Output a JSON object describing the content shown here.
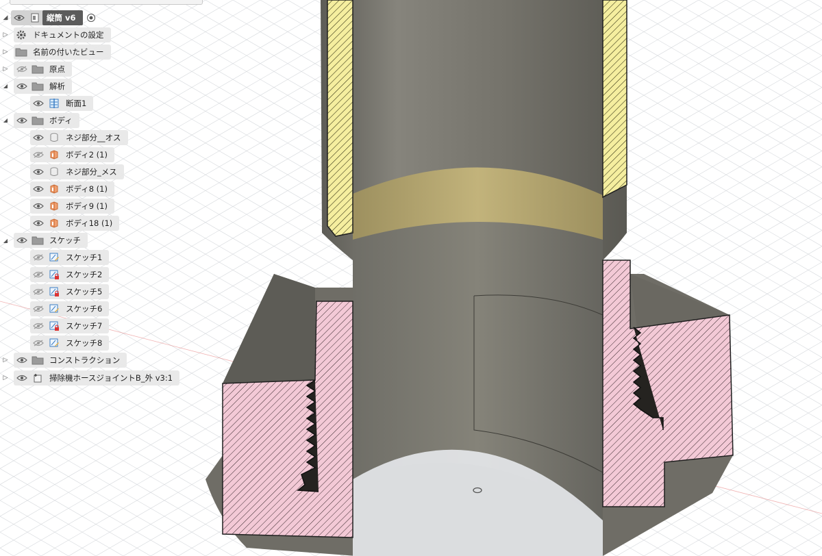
{
  "app": {
    "active_document": "縦筒 v6"
  },
  "browser_tree": {
    "root": {
      "label": "縦筒 v6"
    },
    "nodes": [
      {
        "label": "ドキュメントの設定",
        "icon": "gear-icon",
        "depth": 0,
        "expand": "collapsed",
        "visible": null
      },
      {
        "label": "名前の付いたビュー",
        "icon": "folder-icon",
        "depth": 0,
        "expand": "collapsed",
        "visible": null
      },
      {
        "label": "原点",
        "icon": "folder-icon",
        "depth": 0,
        "expand": "collapsed",
        "visible": false
      },
      {
        "label": "解析",
        "icon": "folder-icon",
        "depth": 0,
        "expand": "expanded",
        "visible": true
      },
      {
        "label": "断面1",
        "icon": "section-analysis-icon",
        "depth": 1,
        "expand": "none",
        "visible": true
      },
      {
        "label": "ボディ",
        "icon": "folder-icon",
        "depth": 0,
        "expand": "expanded",
        "visible": true
      },
      {
        "label": "ネジ部分__オス",
        "icon": "body-white-icon",
        "depth": 1,
        "expand": "none",
        "visible": true
      },
      {
        "label": "ボディ2 (1)",
        "icon": "body-orange-icon",
        "depth": 1,
        "expand": "none",
        "visible": false
      },
      {
        "label": "ネジ部分_メス",
        "icon": "body-white-icon",
        "depth": 1,
        "expand": "none",
        "visible": true
      },
      {
        "label": "ボディ8 (1)",
        "icon": "body-orange-icon",
        "depth": 1,
        "expand": "none",
        "visible": true
      },
      {
        "label": "ボディ9 (1)",
        "icon": "body-orange-icon",
        "depth": 1,
        "expand": "none",
        "visible": true
      },
      {
        "label": "ボディ18 (1)",
        "icon": "body-orange-icon",
        "depth": 1,
        "expand": "none",
        "visible": true
      },
      {
        "label": "スケッチ",
        "icon": "folder-icon",
        "depth": 0,
        "expand": "expanded",
        "visible": true
      },
      {
        "label": "スケッチ1",
        "icon": "sketch-icon",
        "depth": 1,
        "expand": "none",
        "visible": false
      },
      {
        "label": "スケッチ2",
        "icon": "sketch-locked-icon",
        "depth": 1,
        "expand": "none",
        "visible": false
      },
      {
        "label": "スケッチ5",
        "icon": "sketch-locked-icon",
        "depth": 1,
        "expand": "none",
        "visible": false
      },
      {
        "label": "スケッチ6",
        "icon": "sketch-icon",
        "depth": 1,
        "expand": "none",
        "visible": false
      },
      {
        "label": "スケッチ7",
        "icon": "sketch-locked-icon",
        "depth": 1,
        "expand": "none",
        "visible": false
      },
      {
        "label": "スケッチ8",
        "icon": "sketch-icon",
        "depth": 1,
        "expand": "none",
        "visible": false
      },
      {
        "label": "コンストラクション",
        "icon": "folder-icon",
        "depth": 0,
        "expand": "collapsed",
        "visible": true
      },
      {
        "label": "掃除機ホースジョイントB_外 v3:1",
        "icon": "component-link-icon",
        "depth": 0,
        "expand": "collapsed",
        "visible": true
      }
    ]
  },
  "viewport": {
    "colors": {
      "body_gray": "#7c7a72",
      "section_pink": "#f2c6d3",
      "section_yellow": "#f4ec9c",
      "band_tan": "#b8a873",
      "grid_line": "#d5d8dc",
      "axis_red": "#e06060",
      "axis_green": "#7fcf7f"
    }
  }
}
